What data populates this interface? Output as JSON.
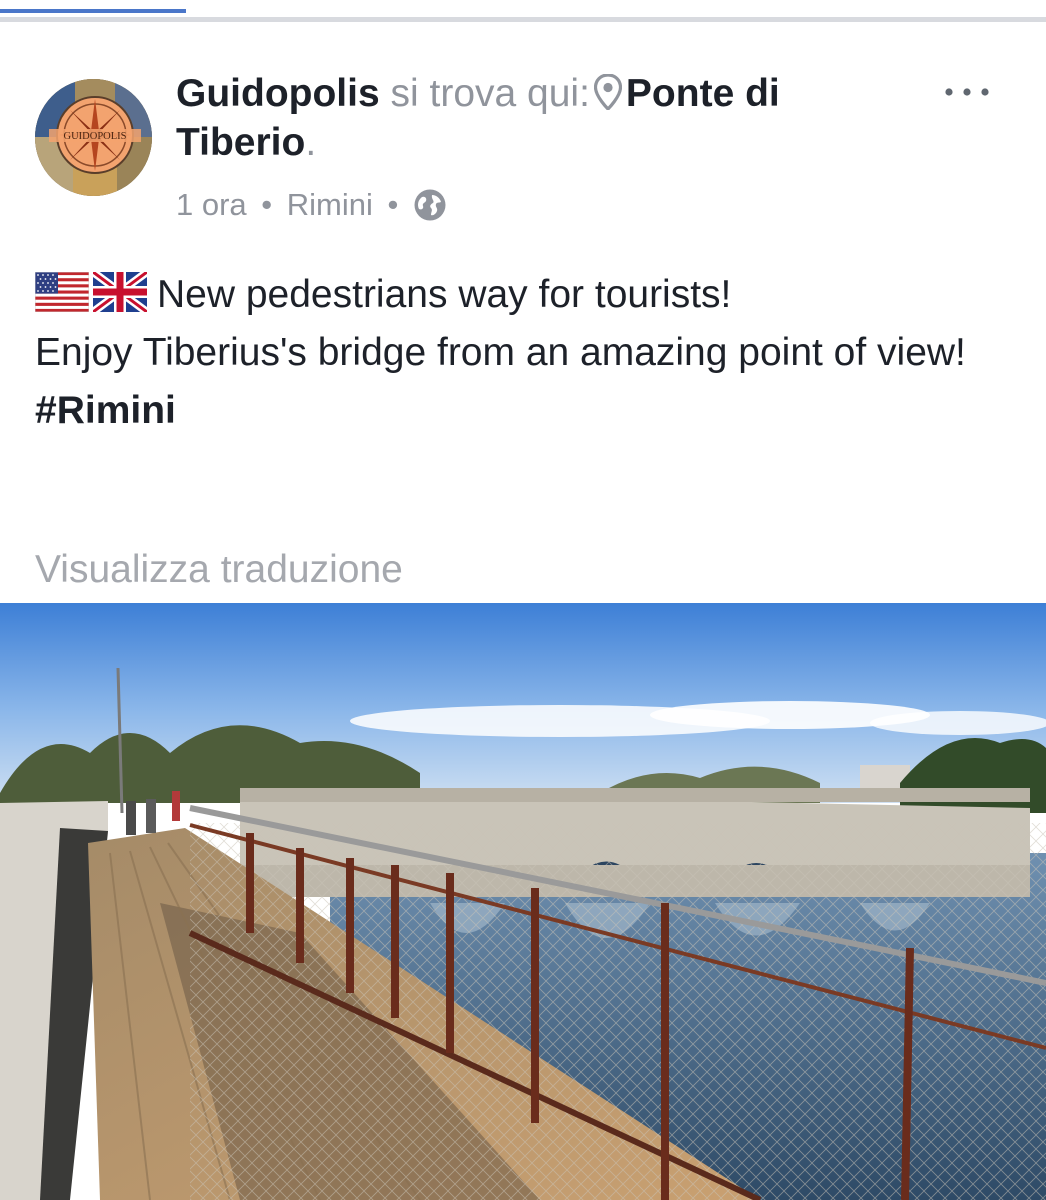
{
  "post": {
    "author": "Guidopolis",
    "location_prefix": "si trova qui:",
    "location_name": "Ponte di Tiberio",
    "location_suffix": ".",
    "time": "1 ora",
    "place": "Rimini",
    "separator": "•",
    "privacy_icon": "globe-icon",
    "more_icon": "more-horizontal-icon",
    "location_icon": "map-pin-icon",
    "avatar_logo_text": "GUIDOPOLIS",
    "flags": [
      "us-flag-icon",
      "uk-flag-icon"
    ],
    "text_line1": "New pedestrians way for tourists!",
    "text_line2": "Enjoy Tiberius's bridge from an amazing point of view!",
    "hashtag": "#Rimini",
    "translate_label": "Visualizza traduzione",
    "photo_subject": "Tiberius bridge pedestrian walkway photo"
  },
  "colors": {
    "primary_text": "#1d2129",
    "secondary_text": "#90949c",
    "translate_text": "#a5a8ae",
    "progress": "#4a76c9"
  }
}
